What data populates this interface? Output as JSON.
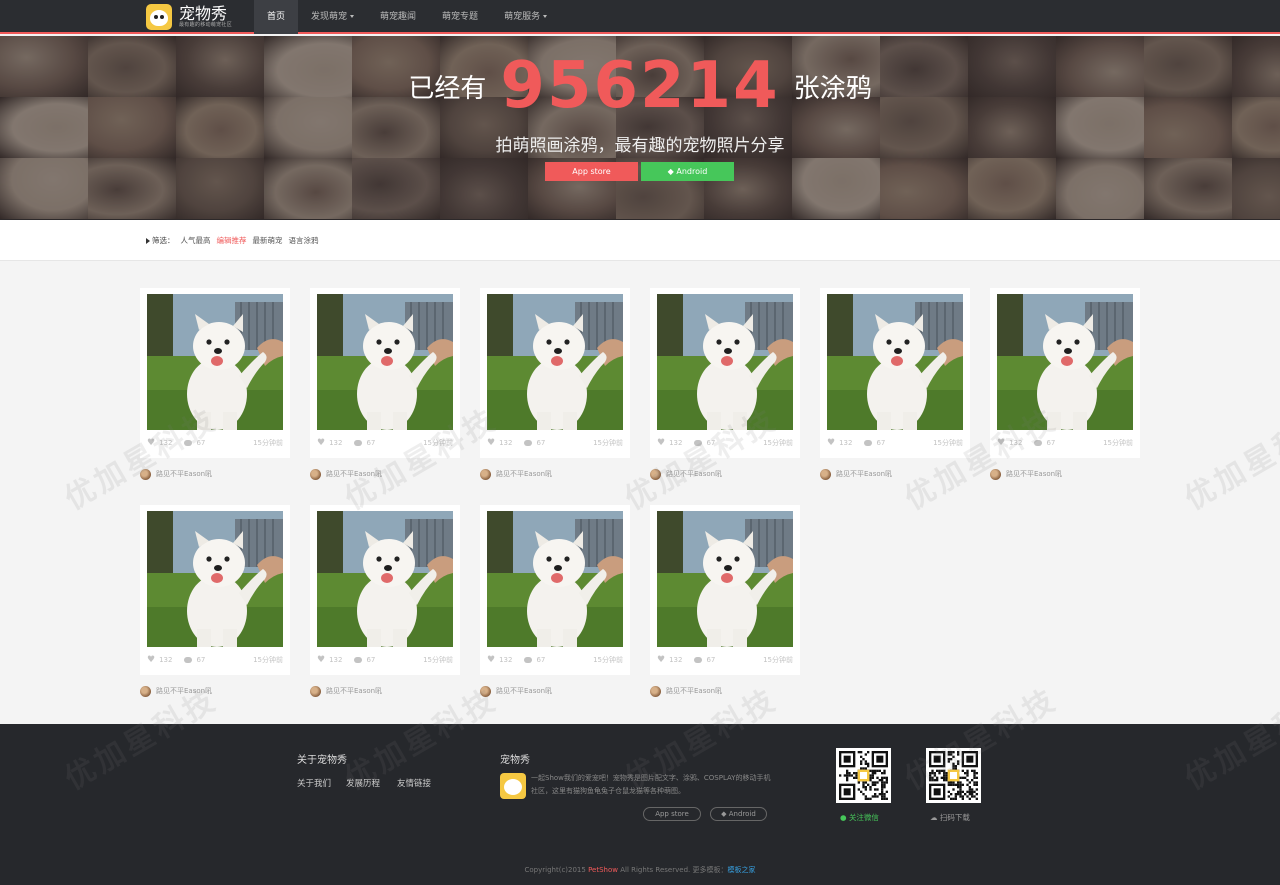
{
  "nav": {
    "brand": "宠物秀",
    "brand_tagline": "最有趣的移动萌宠社区",
    "items": [
      {
        "label": "首页",
        "active": true,
        "dropdown": false
      },
      {
        "label": "发现萌宠",
        "active": false,
        "dropdown": true
      },
      {
        "label": "萌宠趣闻",
        "active": false,
        "dropdown": false
      },
      {
        "label": "萌宠专题",
        "active": false,
        "dropdown": false
      },
      {
        "label": "萌宠服务",
        "active": false,
        "dropdown": true
      }
    ]
  },
  "hero": {
    "pre": "已经有",
    "count": "956214",
    "post": "张涂鸦",
    "slogan": "拍萌照画涂鸦，最有趣的宠物照片分享",
    "ios_label": " App store",
    "android_label": " Android"
  },
  "filter": {
    "label": "筛选：",
    "options": [
      {
        "label": "人气最高",
        "active": false
      },
      {
        "label": "编辑推荐",
        "active": true
      },
      {
        "label": "最新萌宠",
        "active": false
      },
      {
        "label": "语言涂鸦",
        "active": false
      }
    ]
  },
  "posts": [
    {
      "likes": "132",
      "comments": "67",
      "time": "15分钟前",
      "author": "路见不平Eason吼"
    },
    {
      "likes": "132",
      "comments": "67",
      "time": "15分钟前",
      "author": "路见不平Eason吼"
    },
    {
      "likes": "132",
      "comments": "67",
      "time": "15分钟前",
      "author": "路见不平Eason吼"
    },
    {
      "likes": "132",
      "comments": "67",
      "time": "15分钟前",
      "author": "路见不平Eason吼"
    },
    {
      "likes": "132",
      "comments": "67",
      "time": "15分钟前",
      "author": "路见不平Eason吼"
    },
    {
      "likes": "132",
      "comments": "67",
      "time": "15分钟前",
      "author": "路见不平Eason吼"
    },
    {
      "likes": "132",
      "comments": "67",
      "time": "15分钟前",
      "author": "路见不平Eason吼"
    },
    {
      "likes": "132",
      "comments": "67",
      "time": "15分钟前",
      "author": "路见不平Eason吼"
    },
    {
      "likes": "132",
      "comments": "67",
      "time": "15分钟前",
      "author": "路见不平Eason吼"
    },
    {
      "likes": "132",
      "comments": "67",
      "time": "15分钟前",
      "author": "路见不平Eason吼"
    }
  ],
  "footer": {
    "about_title": "关于宠物秀",
    "about_links": [
      "关于我们",
      "发展历程",
      "友情链接"
    ],
    "app_title": "宠物秀",
    "app_desc": "一起Show我们的爱宠吧！宠物秀是图片配文字、涂鸦、COSPLAY的移动手机社区，这里有猫狗鱼龟兔子仓鼠龙猫等各种萌图。",
    "pill_ios": " App store",
    "pill_android": " Android",
    "qr_wechat_caption": "关注微信",
    "qr_download_caption": "扫码下载",
    "copyright_pre": "Copyright(c)2015 ",
    "copyright_brand": "PetShow",
    "copyright_mid": " All Rights Reserved. 更多模板：",
    "copyright_link": "模板之家"
  },
  "watermark": "优加星科技",
  "colors": {
    "accent": "#f05a5a",
    "android": "#46c75a",
    "nav_bg": "#2b2d31",
    "footer_bg": "#26282c",
    "wechat": "#46c75a"
  }
}
